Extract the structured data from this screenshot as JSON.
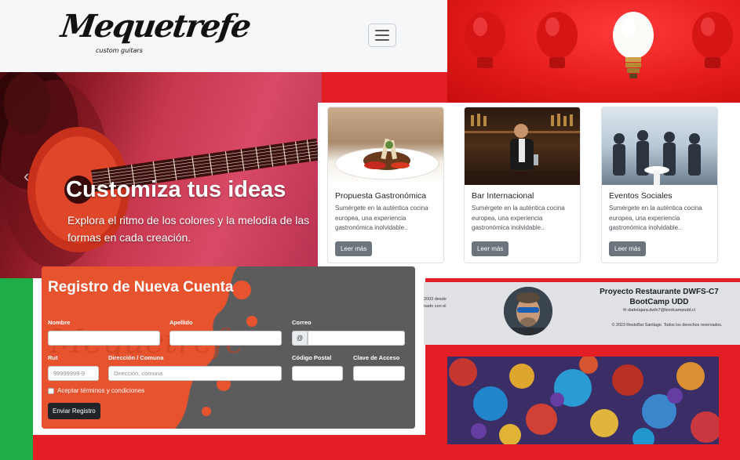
{
  "header": {
    "logo_text": "Mequetrefe",
    "logo_subtext": "custom guitars",
    "menu_icon": "hamburger-menu-icon"
  },
  "hero": {
    "title": "Customiza tus ideas",
    "subtitle": "Explora el ritmo de los colores y la melodía de las formas en cada creación.",
    "prev_icon": "chevron-left-icon"
  },
  "cards": [
    {
      "title": "Propuesta Gastronómica",
      "text": "Sumérgete en la auténtica cocina europea, una experiencia gastronómica inolvidable..",
      "button": "Leer más"
    },
    {
      "title": "Bar Internacional",
      "text": "Sumérgete en la auténtica cocina europea, una experiencia gastronómica inolvidable..",
      "button": "Leer más"
    },
    {
      "title": "Eventos Sociales",
      "text": "Sumérgete en la auténtica cocina europea, una experiencia gastronómica inolvidable..",
      "button": "Leer más"
    }
  ],
  "footer": {
    "left_line1": "2003 desde",
    "left_line2": "nado con el",
    "title": "Proyecto Restaurante DWFS-C7 BootCamp UDD",
    "email": "dadelajara.dwfs7@bootcampudd.cl",
    "copyright": "© 2023 RestoBar Santiago. Todos los derechos reservados."
  },
  "register": {
    "title": "Registro de Nueva Cuenta",
    "labels": {
      "nombre": "Nombre",
      "apellido": "Apellido",
      "correo": "Correo",
      "rut": "Rut",
      "direccion": "Dirección / Comuna",
      "codigo_postal": "Código Postal",
      "clave": "Clave de Acceso"
    },
    "email_addon": "@",
    "placeholders": {
      "rut": "99999999-9",
      "direccion": "Dirección, comuna"
    },
    "terms": "Aceptar términos y condiciones",
    "submit": "Enviar Registro"
  },
  "colors": {
    "background_red": "#e31e24",
    "green_strip": "#1fad4a",
    "secondary_button": "#6c757d",
    "dark_button": "#212529",
    "footer_bg": "#dfe1e4"
  }
}
